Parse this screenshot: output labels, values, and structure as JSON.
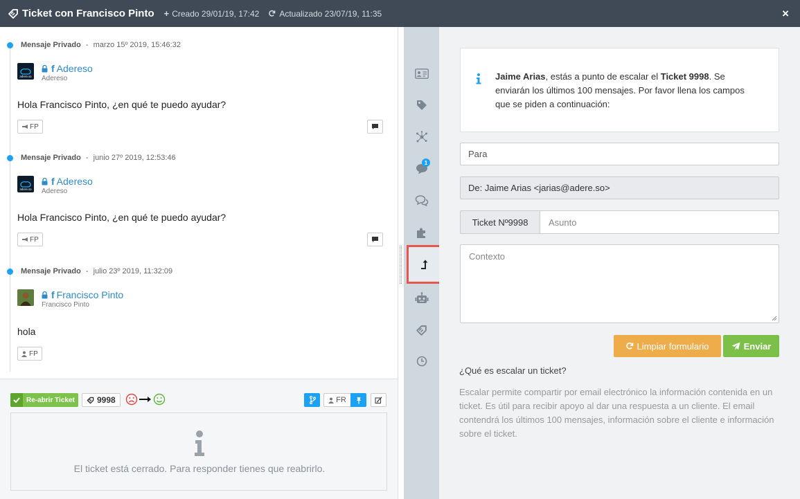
{
  "header": {
    "title": "Ticket con Francisco Pinto",
    "created": "Creado 29/01/19, 17:42",
    "updated": "Actualizado 23/07/19, 11:35",
    "close": "×"
  },
  "messages": [
    {
      "type": "Mensaje Privado",
      "date": "marzo 15º 2019, 15:46:32",
      "author": "Adereso",
      "handle": "Adereso",
      "body": "Hola Francisco Pinto, ¿en qué te puedo ayudar?",
      "chip": "FP",
      "avatar_text": "adere.so"
    },
    {
      "type": "Mensaje Privado",
      "date": "junio 27º 2019, 12:53:46",
      "author": "Adereso",
      "handle": "Adereso",
      "body": "Hola Francisco Pinto, ¿en qué te puedo ayudar?",
      "chip": "FP",
      "avatar_text": "adere.so"
    },
    {
      "type": "Mensaje Privado",
      "date": "julio 23º 2019, 11:32:09",
      "author": "Francisco Pinto",
      "handle": "Francisco Pinto",
      "body": "hola",
      "chip": "FP"
    }
  ],
  "message_separator": "-",
  "bottom": {
    "reopen_label": "Re-abrir Ticket",
    "ticket_number": "9998",
    "assignee": "FR",
    "closed_notice": "El ticket está cerrado. Para responder tienes que reabrirlo."
  },
  "iconbar": {
    "badge_count": "1"
  },
  "escalate": {
    "info_name": "Jaime Arias",
    "info_mid": ", estás a punto de escalar el ",
    "info_ticket": "Ticket 9998",
    "info_rest": ". Se enviarán los últimos 100 mensajes. Por favor llena los campos que se piden a continuación:",
    "to_placeholder": "Para",
    "from_value": "De: Jaime Arias <jarias@adere.so>",
    "ticket_addon": "Ticket Nº9998",
    "subject_placeholder": "Asunto",
    "context_placeholder": "Contexto",
    "clear_label": "Limpiar formulario",
    "send_label": "Enviar",
    "question": "¿Qué es escalar un ticket?",
    "explanation": "Escalar permite compartir por email electrónico la información contenida en un ticket. Es útil para recibir apoyo al dar una respuesta a un cliente. El email contendrá los últimos 100 mensajes, información sobre el cliente e información sobre el ticket."
  },
  "colors": {
    "header_bg": "#3f4a56",
    "accent_blue": "#1da1f2",
    "link_blue": "#2f8bc6",
    "green": "#7cc04a",
    "orange": "#efac4a",
    "highlight_red": "#e8554e",
    "iconbar_bg": "#cfd8df"
  }
}
